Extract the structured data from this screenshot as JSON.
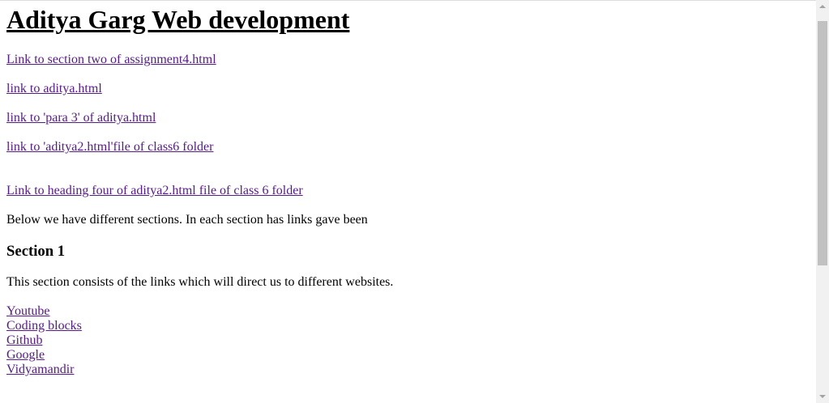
{
  "title": "Aditya Garg Web development",
  "links": [
    "Link to section two of assignment4.html",
    "link to aditya.html",
    "link to 'para 3' of aditya.html",
    "link to 'aditya2.html'file of class6 folder",
    "Link to heading four of aditya2.html file of class 6 folder"
  ],
  "intro": "Below we have different sections. In each section has links gave been",
  "section1": {
    "heading": "Section 1",
    "description": "This section consists of the links which will direct us to different websites.",
    "links": [
      "Youtube",
      "Coding blocks",
      "Github",
      "Google",
      "Vidyamandir"
    ]
  },
  "colors": {
    "link": "#551a8b",
    "text": "#000000"
  }
}
